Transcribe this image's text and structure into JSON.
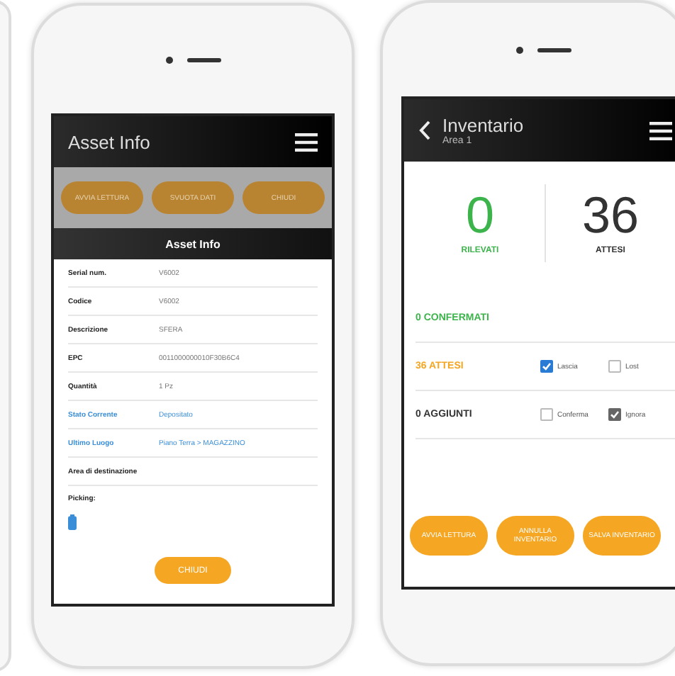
{
  "asset_screen": {
    "title": "Asset Info",
    "background_buttons": [
      "AVVIA LETTURA",
      "SVUOTA DATI",
      "CHIUDI"
    ],
    "dialog": {
      "title": "Asset Info",
      "fields": [
        {
          "label": "Serial num.",
          "value": "V6002",
          "kind": "plain"
        },
        {
          "label": "Codice",
          "value": "V6002",
          "kind": "plain"
        },
        {
          "label": "Descrizione",
          "value": "SFERA",
          "kind": "plain"
        },
        {
          "label": "EPC",
          "value": "0011000000010F30B6C4",
          "kind": "plain"
        },
        {
          "label": "Quantità",
          "value": "1 Pz",
          "kind": "plain"
        },
        {
          "label": "Stato Corrente",
          "value": "Depositato",
          "kind": "link"
        },
        {
          "label": "Ultimo Luogo",
          "value": "Piano Terra > MAGAZZINO",
          "kind": "link"
        },
        {
          "label": "Area di destinazione",
          "kind": "plain"
        },
        {
          "label": "Picking:",
          "kind": "picking"
        }
      ],
      "button": "CHIUDI"
    }
  },
  "inventory_screen": {
    "title": "Inventario",
    "subtitle": "Area 1",
    "counters": [
      {
        "value": "0",
        "label": "RILEVATI",
        "color": "#3cb44b"
      },
      {
        "value": "36",
        "label": "ATTESI",
        "color": "#333333"
      }
    ],
    "rows": [
      {
        "label": "0 CONFERMATI",
        "color": "#3cb44b",
        "options": []
      },
      {
        "label": "36 ATTESI",
        "color": "#f5a623",
        "options": [
          {
            "label": "Lascia",
            "checked": true,
            "color": "#2a7bd4"
          },
          {
            "label": "Lost",
            "checked": false,
            "color": "#ffffff"
          }
        ]
      },
      {
        "label": "0 AGGIUNTI",
        "color": "#333333",
        "options": [
          {
            "label": "Conferma",
            "checked": false,
            "color": "#ffffff"
          },
          {
            "label": "Ignora",
            "checked": true,
            "color": "#666666"
          }
        ]
      }
    ],
    "buttons": [
      "AVVIA LETTURA",
      "ANNULLA INVENTARIO",
      "SALVA INVENTARIO"
    ]
  }
}
